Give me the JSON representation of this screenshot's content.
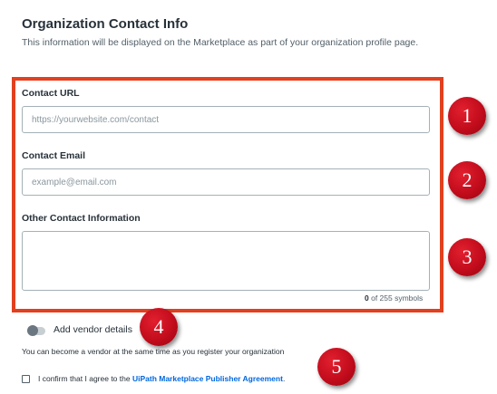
{
  "section": {
    "title": "Organization Contact Info",
    "subtitle": "This information will be displayed on the Marketplace as part of your organization profile page."
  },
  "form": {
    "contact_url": {
      "label": "Contact URL",
      "placeholder": "https://yourwebsite.com/contact"
    },
    "contact_email": {
      "label": "Contact Email",
      "placeholder": "example@email.com"
    },
    "other_contact": {
      "label": "Other Contact Information",
      "count": "0",
      "counter_suffix": "of 255 symbols"
    }
  },
  "vendor": {
    "toggle_label": "Add vendor details",
    "help_text": "You can become a vendor at the same time as you register your organization"
  },
  "agreement": {
    "prefix": "I confirm that I agree to the",
    "link_text": "UiPath Marketplace Publisher Agreement",
    "suffix": "."
  },
  "markers": [
    "1",
    "2",
    "3",
    "4",
    "5"
  ],
  "colors": {
    "highlight_border": "#e2401f",
    "marker_red": "#c20c1c",
    "link_blue": "#0067df"
  }
}
